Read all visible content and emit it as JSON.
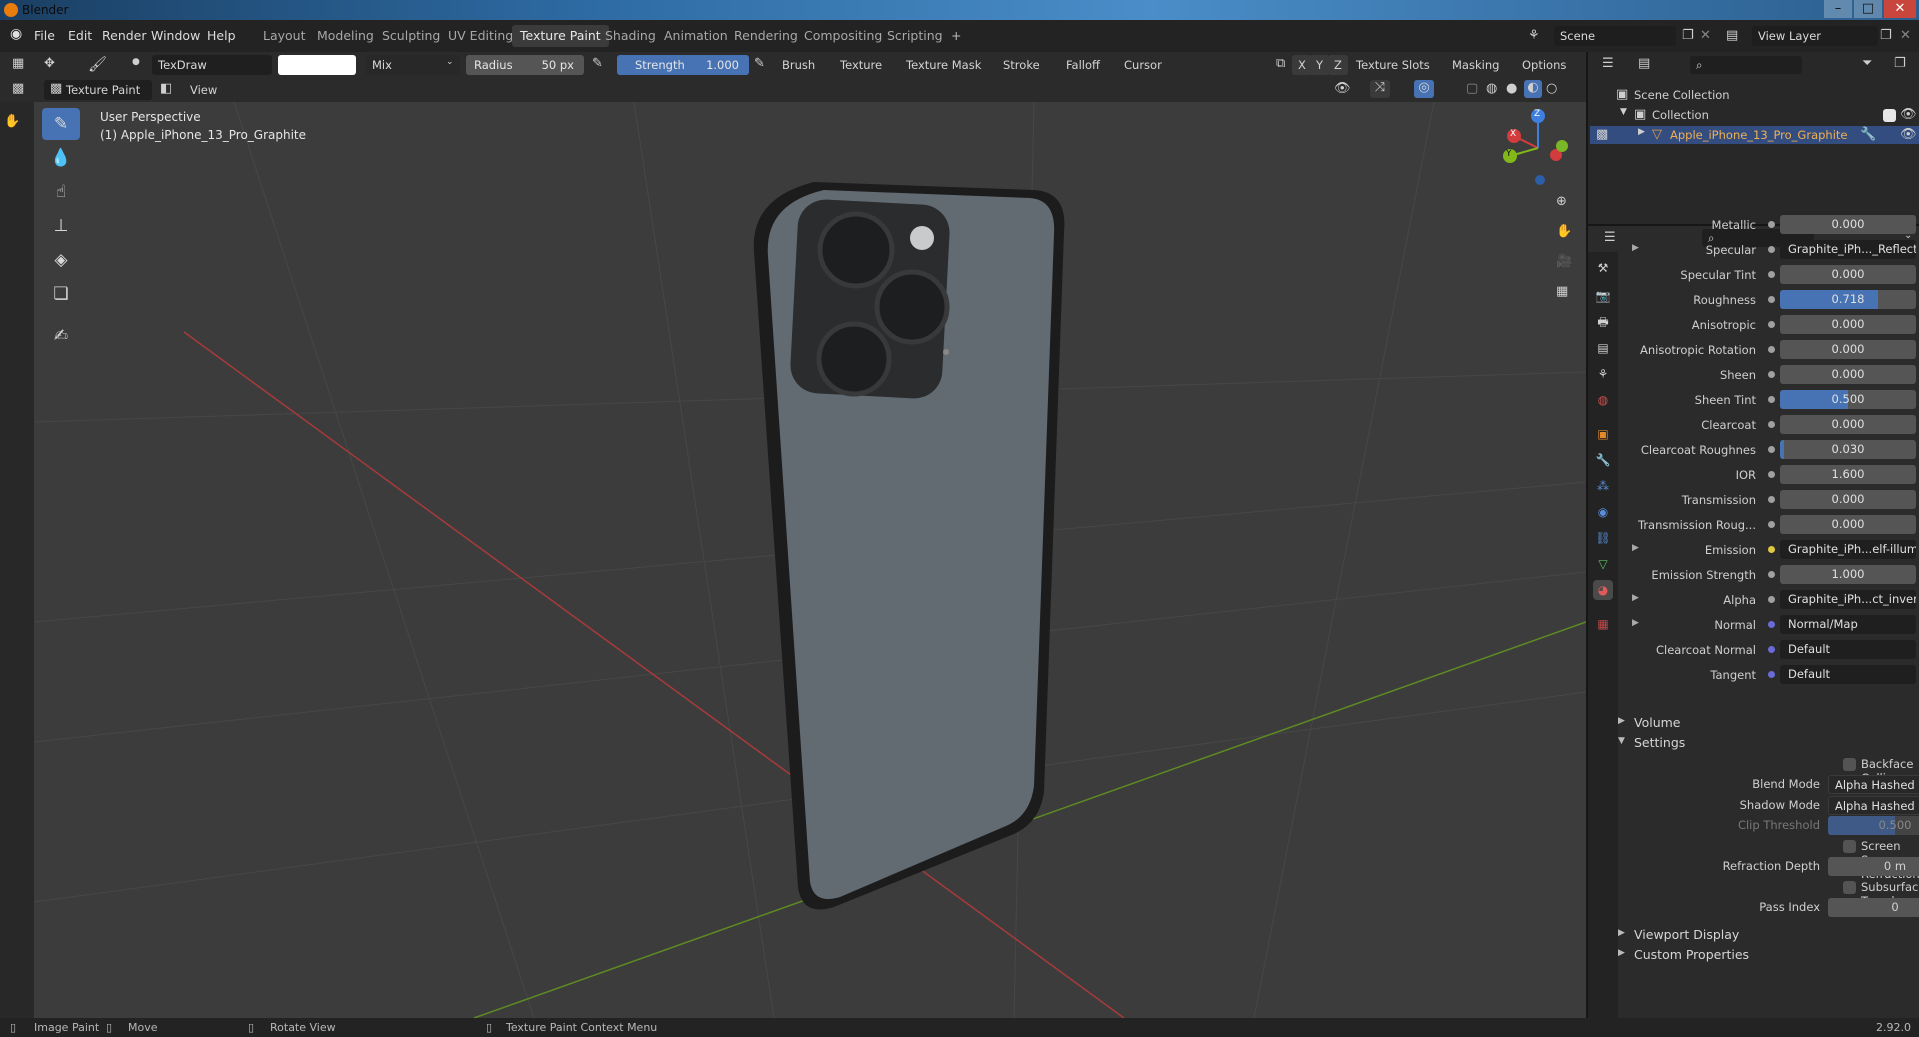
{
  "window": {
    "title": "Blender"
  },
  "menus": [
    "File",
    "Edit",
    "Render",
    "Window",
    "Help"
  ],
  "workspaces": [
    "Layout",
    "Modeling",
    "Sculpting",
    "UV Editing",
    "Texture Paint",
    "Shading",
    "Animation",
    "Rendering",
    "Compositing",
    "Scripting"
  ],
  "active_workspace": "Texture Paint",
  "scene": {
    "label": "Scene",
    "view_layer": "View Layer"
  },
  "tool_header": {
    "brush_name": "TexDraw",
    "blend": "Mix",
    "radius_label": "Radius",
    "radius_value": "50 px",
    "strength_label": "Strength",
    "strength_value": "1.000",
    "strength_fraction": 1.0,
    "menus": [
      "Brush",
      "Texture",
      "Texture Mask",
      "Stroke",
      "Falloff",
      "Cursor"
    ],
    "axes": [
      "X",
      "Y",
      "Z"
    ],
    "right_menus": [
      "Texture Slots",
      "Masking",
      "Options"
    ]
  },
  "header2": {
    "mode": "Texture Paint",
    "view": "View"
  },
  "viewport": {
    "perspective": "User Perspective",
    "object": "(1) Apple_iPhone_13_Pro_Graphite",
    "gizmo": {
      "x": "X",
      "y": "Y",
      "z": "Z"
    }
  },
  "outliner": {
    "scene_collection": "Scene Collection",
    "collection": "Collection",
    "object": "Apple_iPhone_13_Pro_Graphite"
  },
  "properties": {
    "rows": [
      {
        "label": "Metallic",
        "value": "0.000",
        "type": "slider",
        "fill": 0
      },
      {
        "label": "Specular",
        "value": "Graphite_iPh..._Reflect.png",
        "type": "texture",
        "expand": true
      },
      {
        "label": "Specular Tint",
        "value": "0.000",
        "type": "slider",
        "fill": 0
      },
      {
        "label": "Roughness",
        "value": "0.718",
        "type": "slider",
        "fill": 0.718
      },
      {
        "label": "Anisotropic",
        "value": "0.000",
        "type": "slider",
        "fill": 0
      },
      {
        "label": "Anisotropic Rotation",
        "value": "0.000",
        "type": "slider",
        "fill": 0
      },
      {
        "label": "Sheen",
        "value": "0.000",
        "type": "slider",
        "fill": 0
      },
      {
        "label": "Sheen Tint",
        "value": "0.500",
        "type": "slider",
        "fill": 0.5
      },
      {
        "label": "Clearcoat",
        "value": "0.000",
        "type": "slider",
        "fill": 0
      },
      {
        "label": "Clearcoat Roughnes",
        "value": "0.030",
        "type": "slider",
        "fill": 0.03
      },
      {
        "label": "IOR",
        "value": "1.600",
        "type": "slider",
        "fill": 0
      },
      {
        "label": "Transmission",
        "value": "0.000",
        "type": "slider",
        "fill": 0
      },
      {
        "label": "Transmission Roug...",
        "value": "0.000",
        "type": "slider",
        "fill": 0
      },
      {
        "label": "Emission",
        "value": "Graphite_iPh...elf-illum.png",
        "type": "texture",
        "expand": true,
        "dot": "#e0c840"
      },
      {
        "label": "Emission Strength",
        "value": "1.000",
        "type": "slider",
        "fill": 0
      },
      {
        "label": "Alpha",
        "value": "Graphite_iPh...ct_invert.pn",
        "type": "texture",
        "expand": true
      },
      {
        "label": "Normal",
        "value": "Normal/Map",
        "type": "texture",
        "expand": true,
        "dot": "#6b6bd8"
      },
      {
        "label": "Clearcoat Normal",
        "value": "Default",
        "type": "texture",
        "dot": "#6b6bd8"
      },
      {
        "label": "Tangent",
        "value": "Default",
        "type": "texture",
        "dot": "#6b6bd8"
      }
    ],
    "volume": "Volume",
    "settings": "Settings",
    "backface_culling": "Backface Culling",
    "blend_mode_label": "Blend Mode",
    "blend_mode": "Alpha Hashed",
    "shadow_mode_label": "Shadow Mode",
    "shadow_mode": "Alpha Hashed",
    "clip_threshold_label": "Clip Threshold",
    "clip_threshold": "0.500",
    "ssr": "Screen Space Refraction",
    "refraction_depth_label": "Refraction Depth",
    "refraction_depth": "0 m",
    "subsurface": "Subsurface Translucency",
    "pass_index_label": "Pass Index",
    "pass_index": "0",
    "viewport_display": "Viewport Display",
    "custom_properties": "Custom Properties"
  },
  "status": {
    "image_paint": "Image Paint",
    "move": "Move",
    "rotate": "Rotate View",
    "context": "Texture Paint Context Menu",
    "version": "2.92.0"
  },
  "colors": {
    "accent": "#4772b3",
    "viewport_bg": "#3c3c3c",
    "x_axis": "#c33c3c",
    "y_axis": "#6a9a28",
    "object_active": "#e2a03a"
  }
}
